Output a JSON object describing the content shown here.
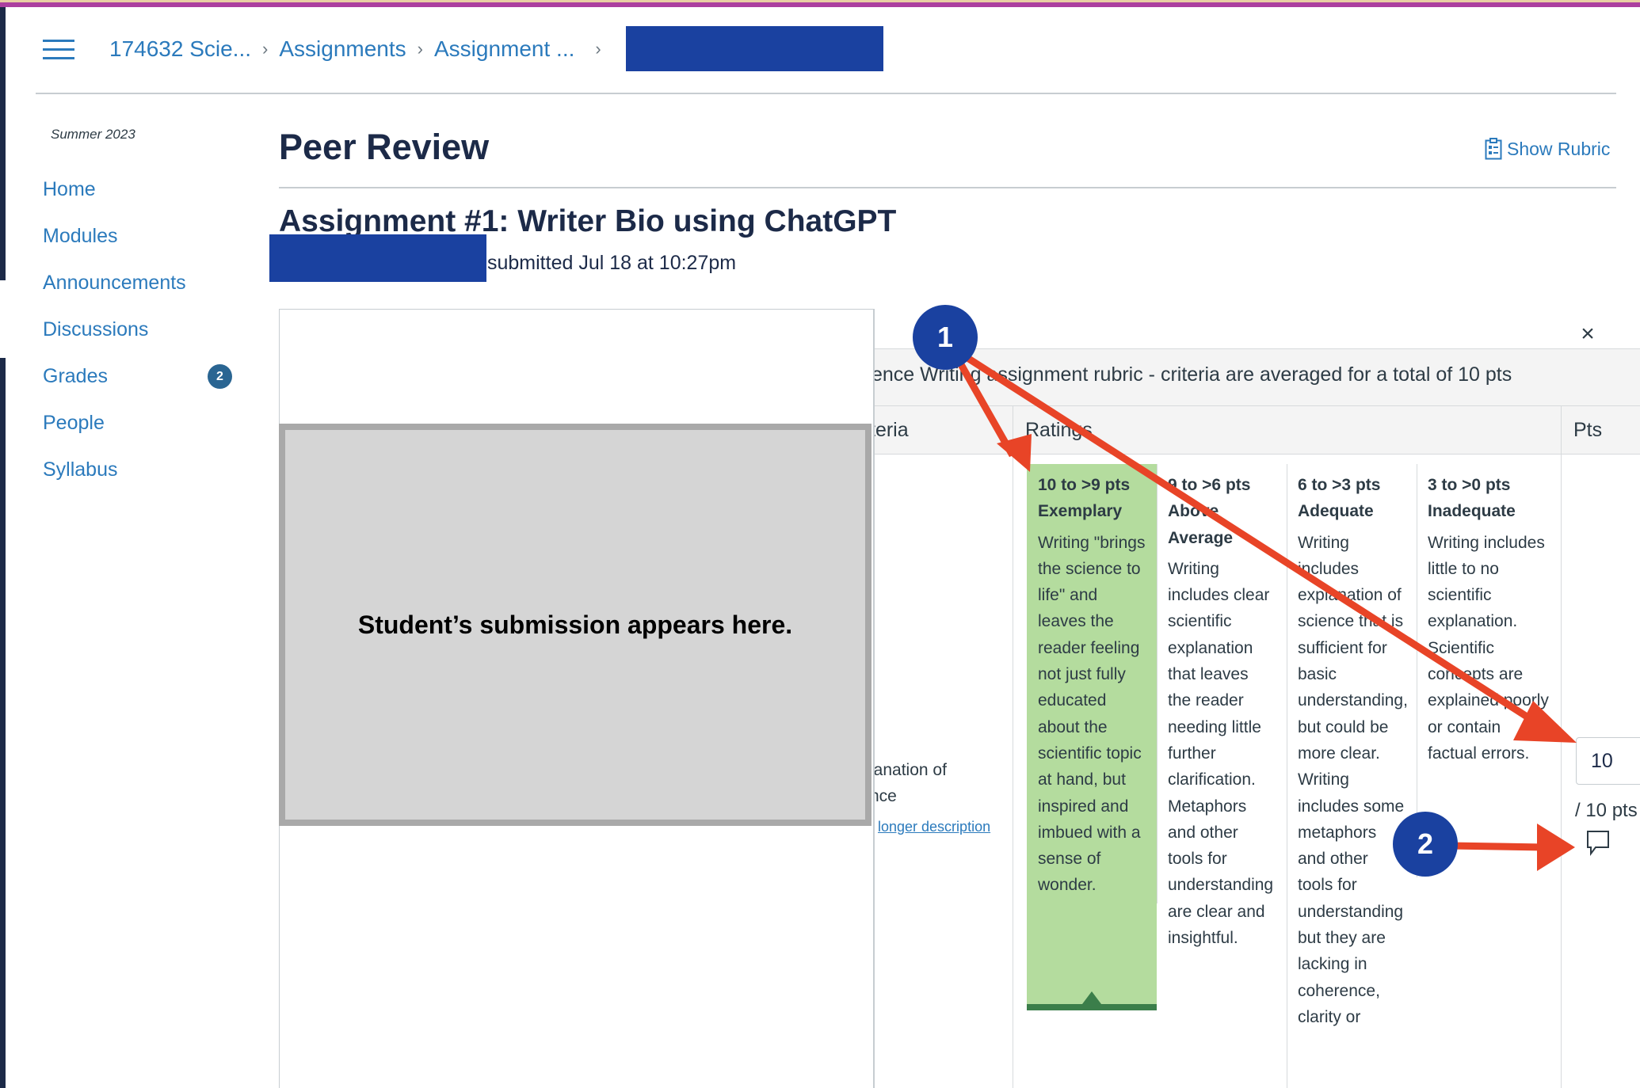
{
  "colors": {
    "accent": "#2b7abc",
    "brand_bar": "#ac3f9f",
    "redaction": "#1a41a0",
    "selected_rating": "#b4dc9e",
    "selected_bar": "#3b7e4a",
    "annotation_arrow": "#e84427"
  },
  "breadcrumb": {
    "items": [
      "174632 Scie...",
      "Assignments",
      "Assignment ..."
    ],
    "separator": "›"
  },
  "sidebar": {
    "term": "Summer 2023",
    "items": [
      {
        "label": "Home"
      },
      {
        "label": "Modules"
      },
      {
        "label": "Announcements"
      },
      {
        "label": "Discussions"
      },
      {
        "label": "Grades",
        "badge": "2"
      },
      {
        "label": "People"
      },
      {
        "label": "Syllabus"
      }
    ]
  },
  "main": {
    "page_title": "Peer Review",
    "show_rubric_label": "Show Rubric",
    "assignment_title": "Assignment #1: Writer Bio using ChatGPT",
    "submitted_text": "submitted Jul 18 at 10:27pm",
    "submission_placeholder": "Student’s submission appears here."
  },
  "rubric": {
    "close_icon": "×",
    "title": "ence Writing assignment rubric - criteria are averaged for a total of 10 pts",
    "headers": {
      "criteria": "teria",
      "ratings": "Ratings",
      "pts": "Pts"
    },
    "criterion": {
      "description_lines": [
        "lanation of",
        "nce"
      ],
      "link": " longer description"
    },
    "ratings": [
      {
        "pts": "10 to >9 pts",
        "name": "Exemplary",
        "description": "Writing \"brings the science to life\" and leaves the reader feeling not just fully educated about the scientific topic at hand, but inspired and imbued with a sense of wonder.",
        "selected": true
      },
      {
        "pts": "9 to >6 pts",
        "name": "Above Average",
        "description": "Writing includes clear scientific explanation that leaves the reader needing little further clarification. Metaphors and other tools for understanding are clear and insightful.",
        "selected": false
      },
      {
        "pts": "6 to >3 pts",
        "name": "Adequate",
        "description": "Writing includes explanation of science that is sufficient for basic understanding, but could be more clear. Writing includes some metaphors and other tools for understanding but they are lacking in coherence, clarity or",
        "selected": false
      },
      {
        "pts": "3 to >0 pts",
        "name": "Inadequate",
        "description": "Writing includes little to no scientific explanation. Scientific concepts are explained poorly or contain factual errors.",
        "selected": false
      }
    ],
    "score_value": "10",
    "score_out_of": "/ 10 pts"
  },
  "annotations": {
    "callout_1": "1",
    "callout_2": "2"
  }
}
